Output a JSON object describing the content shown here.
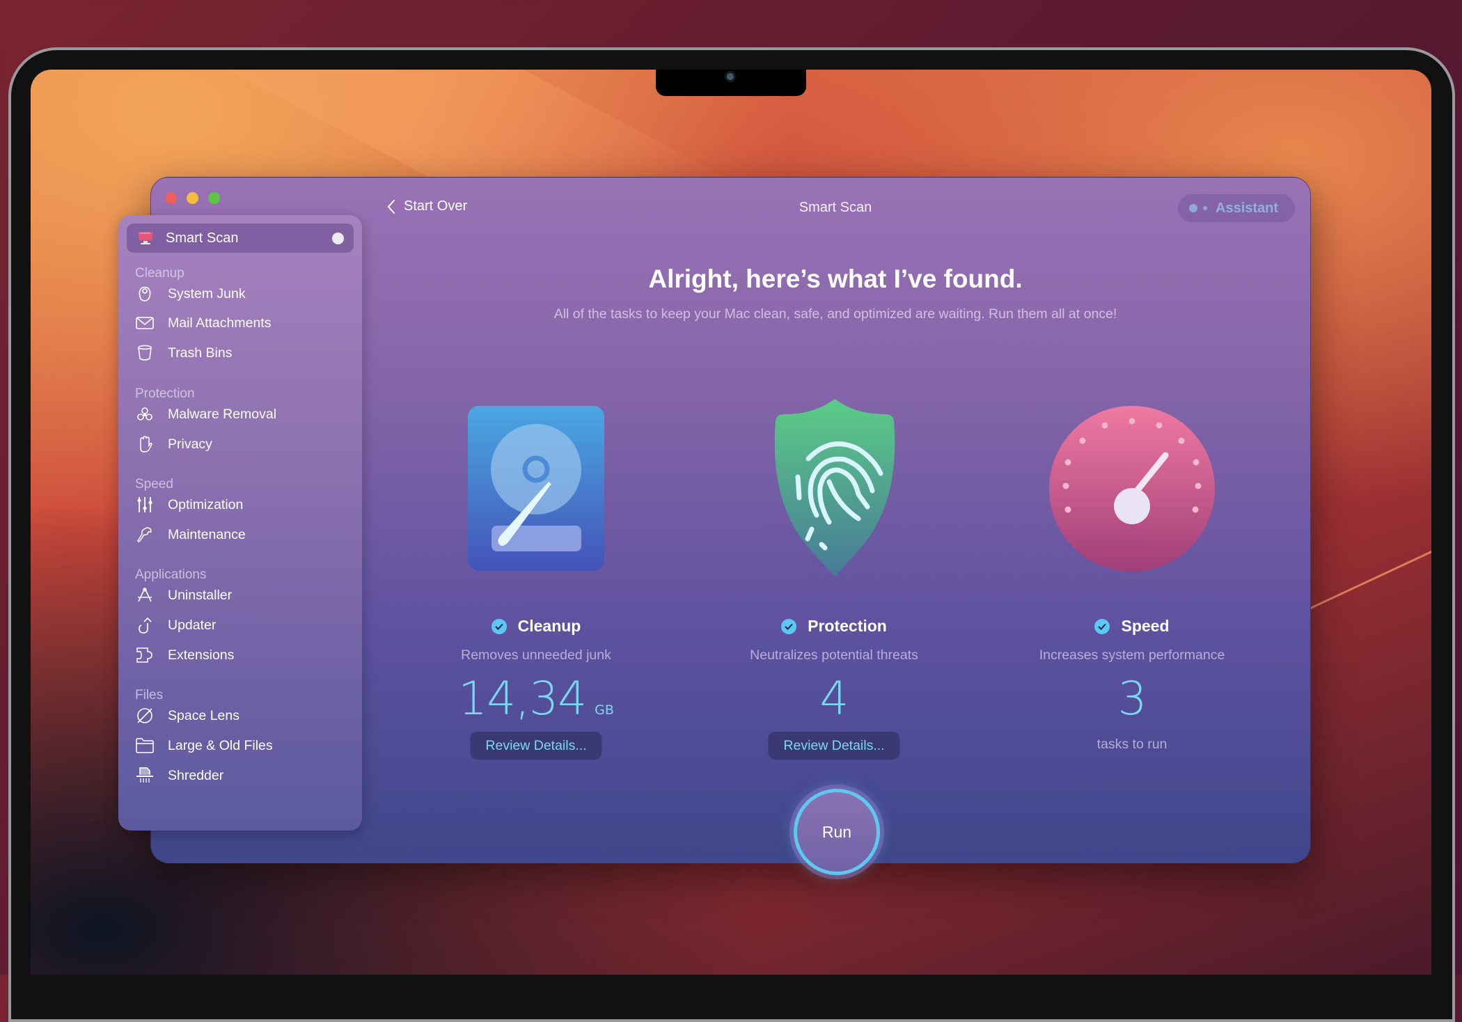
{
  "window": {
    "traffic_lights": [
      "close",
      "minimize",
      "maximize"
    ],
    "title": "Smart Scan",
    "back_label": "Start Over",
    "assistant_label": "Assistant"
  },
  "sidebar": {
    "active": {
      "label": "Smart Scan",
      "icon": "monitor-icon"
    },
    "sections": [
      {
        "title": "Cleanup",
        "items": [
          {
            "label": "System Junk",
            "icon": "system-junk-icon"
          },
          {
            "label": "Mail Attachments",
            "icon": "envelope-icon"
          },
          {
            "label": "Trash Bins",
            "icon": "trash-bin-icon"
          }
        ]
      },
      {
        "title": "Protection",
        "items": [
          {
            "label": "Malware Removal",
            "icon": "biohazard-icon"
          },
          {
            "label": "Privacy",
            "icon": "hand-icon"
          }
        ]
      },
      {
        "title": "Speed",
        "items": [
          {
            "label": "Optimization",
            "icon": "sliders-icon"
          },
          {
            "label": "Maintenance",
            "icon": "wrench-icon"
          }
        ]
      },
      {
        "title": "Applications",
        "items": [
          {
            "label": "Uninstaller",
            "icon": "uninstaller-icon"
          },
          {
            "label": "Updater",
            "icon": "updater-icon"
          },
          {
            "label": "Extensions",
            "icon": "puzzle-icon"
          }
        ]
      },
      {
        "title": "Files",
        "items": [
          {
            "label": "Space Lens",
            "icon": "planet-icon"
          },
          {
            "label": "Large & Old Files",
            "icon": "folder-icon"
          },
          {
            "label": "Shredder",
            "icon": "shredder-icon"
          }
        ]
      }
    ]
  },
  "main": {
    "headline": "Alright, here’s what I’ve found.",
    "subline": "All of the tasks to keep your Mac clean, safe, and optimized are waiting. Run them all at once!",
    "cards": [
      {
        "title": "Cleanup",
        "description": "Removes unneeded junk",
        "value": "14,34",
        "unit": "GB",
        "action": "Review Details...",
        "icon": "hard-drive-icon"
      },
      {
        "title": "Protection",
        "description": "Neutralizes potential threats",
        "value": "4",
        "action": "Review Details...",
        "icon": "shield-fingerprint-icon"
      },
      {
        "title": "Speed",
        "description": "Increases system performance",
        "value": "3",
        "caption": "tasks to run",
        "icon": "speedometer-icon"
      }
    ],
    "run_label": "Run"
  },
  "colors": {
    "accent": "#5ec9f0",
    "check": "#5dc7f3",
    "traffic_close": "#ee5f5a",
    "traffic_min": "#f5be3a",
    "traffic_max": "#5cc443"
  }
}
